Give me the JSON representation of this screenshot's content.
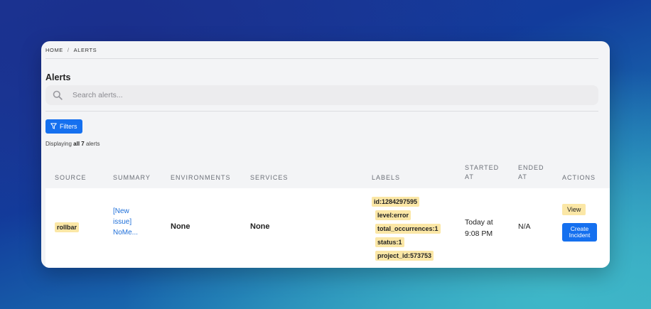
{
  "breadcrumb": {
    "home": "HOME",
    "separator": "/",
    "current": "ALERTS"
  },
  "page": {
    "title": "Alerts"
  },
  "search": {
    "placeholder": "Search alerts...",
    "icon": "search-icon"
  },
  "filters": {
    "label": "Filters",
    "icon": "filter-icon"
  },
  "count": {
    "prefix": "Displaying ",
    "bold": "all 7",
    "suffix": " alerts"
  },
  "table": {
    "headers": {
      "source": "SOURCE",
      "summary": "SUMMARY",
      "environments": "ENVIRONMENTS",
      "services": "SERVICES",
      "labels": "LABELS",
      "started_1": "STARTED",
      "started_2": "AT",
      "ended_1": "ENDED",
      "ended_2": "AT",
      "actions": "ACTIONS"
    },
    "rows": [
      {
        "source": "rollbar",
        "summary_lines": [
          "[New",
          "issue]",
          "NoMe..."
        ],
        "environments": "None",
        "services": "None",
        "labels": [
          "id:1284297595",
          "level:error",
          "total_occurrences:1",
          "status:1",
          "project_id:573753"
        ],
        "started_1": "Today at",
        "started_2": "9:08 PM",
        "ended": "N/A",
        "view_label": "View",
        "create_label_1": "Create",
        "create_label_2": "Incident"
      }
    ]
  },
  "colors": {
    "accent": "#1570ef",
    "badge": "#fbe7a6",
    "link": "#1e6fd9"
  }
}
